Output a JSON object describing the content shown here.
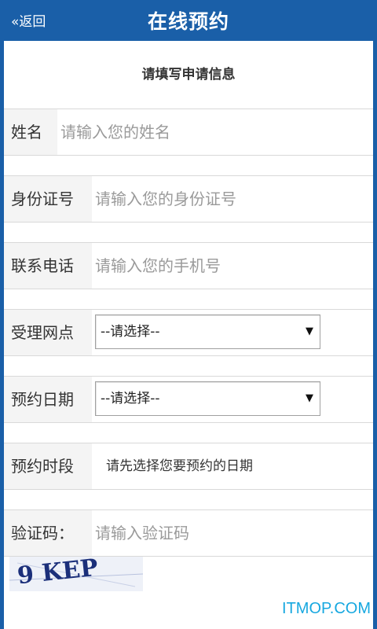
{
  "header": {
    "back_label": "«返回",
    "title": "在线预约"
  },
  "form": {
    "subtitle": "请填写申请信息",
    "name": {
      "label": "姓名",
      "placeholder": "请输入您的姓名"
    },
    "id_number": {
      "label": "身份证号",
      "placeholder": "请输入您的身份证号"
    },
    "phone": {
      "label": "联系电话",
      "placeholder": "请输入您的手机号"
    },
    "branch": {
      "label": "受理网点",
      "selected": "--请选择--"
    },
    "date": {
      "label": "预约日期",
      "selected": "--请选择--"
    },
    "time_slot": {
      "label": "预约时段",
      "hint": "请先选择您要预约的日期"
    },
    "captcha": {
      "label": "验证码：",
      "placeholder": "请输入验证码",
      "image_text": "9 KEP"
    }
  },
  "watermark": "ITMOP.COM",
  "colors": {
    "header_bg": "#1a5fa8",
    "watermark": "#17a8e0"
  }
}
